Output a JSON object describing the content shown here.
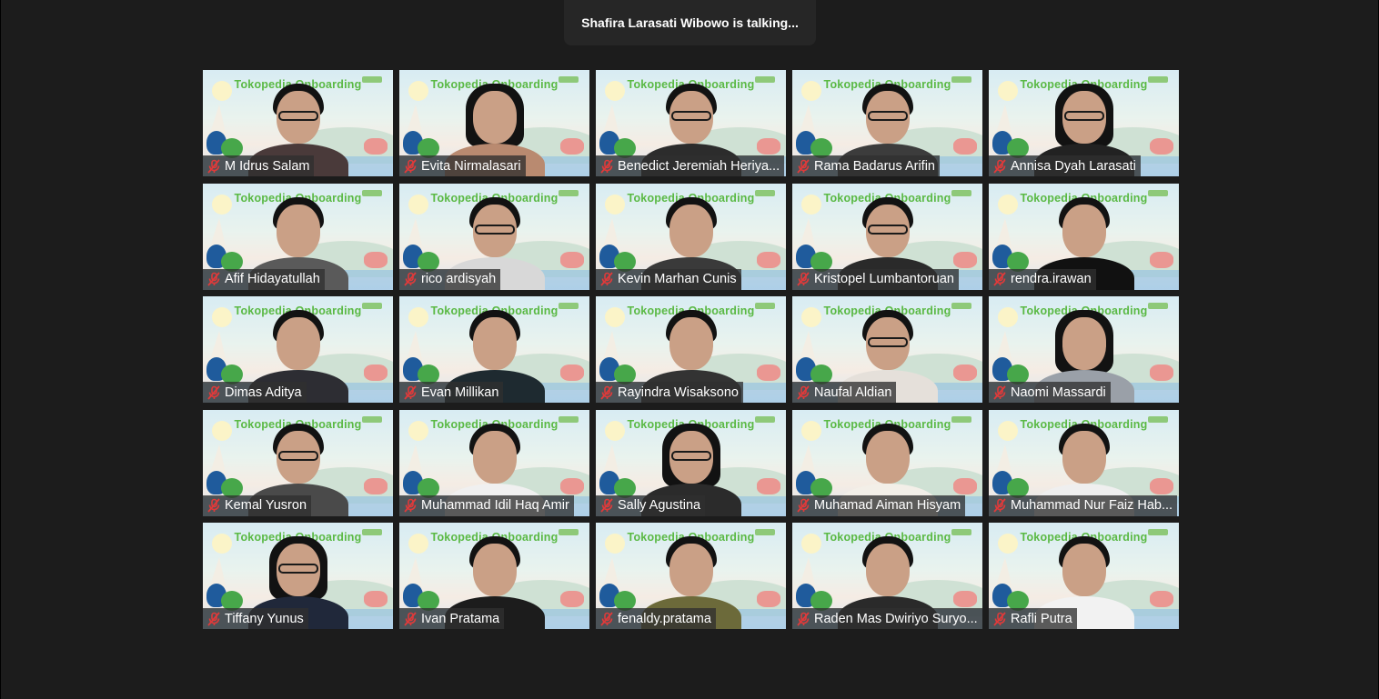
{
  "status": {
    "talking_text": "Shafira Larasati Wibowo is talking..."
  },
  "meeting": {
    "background_banner": "Tokopedia Onboarding"
  },
  "colors": {
    "background": "#1c1c1c",
    "banner_green": "#5ab944",
    "muted_red": "#e03a3a",
    "nameplate": "#303030"
  },
  "icons": {
    "muted": "microphone-muted-icon"
  },
  "participants": [
    {
      "name": "M Idrus Salam",
      "muted": true
    },
    {
      "name": "Evita Nirmalasari",
      "muted": true
    },
    {
      "name": "Benedict Jeremiah Heriya...",
      "muted": true
    },
    {
      "name": "Rama Badarus Arifin",
      "muted": true
    },
    {
      "name": "Annisa Dyah Larasati",
      "muted": true
    },
    {
      "name": "Afif Hidayatullah",
      "muted": true
    },
    {
      "name": "rico ardisyah",
      "muted": true
    },
    {
      "name": "Kevin Marhan Cunis",
      "muted": true
    },
    {
      "name": "Kristopel Lumbantoruan",
      "muted": true
    },
    {
      "name": "rendra.irawan",
      "muted": true
    },
    {
      "name": "Dimas Aditya",
      "muted": true
    },
    {
      "name": "Evan Millikan",
      "muted": true
    },
    {
      "name": "Rayindra Wisaksono",
      "muted": true
    },
    {
      "name": "Naufal Aldian",
      "muted": true
    },
    {
      "name": "Naomi Massardi",
      "muted": true
    },
    {
      "name": "Kemal Yusron",
      "muted": true
    },
    {
      "name": "Muhammad Idil Haq Amir",
      "muted": true
    },
    {
      "name": "Sally Agustina",
      "muted": true
    },
    {
      "name": "Muhamad Aiman Hisyam",
      "muted": true
    },
    {
      "name": "Muhammad Nur Faiz Hab...",
      "muted": true
    },
    {
      "name": "Tiffany Yunus",
      "muted": true
    },
    {
      "name": "Ivan Pratama",
      "muted": true
    },
    {
      "name": "fenaldy.pratama",
      "muted": true
    },
    {
      "name": "Raden Mas Dwiriyo Suryo...",
      "muted": true
    },
    {
      "name": "Rafli Putra",
      "muted": true
    }
  ]
}
